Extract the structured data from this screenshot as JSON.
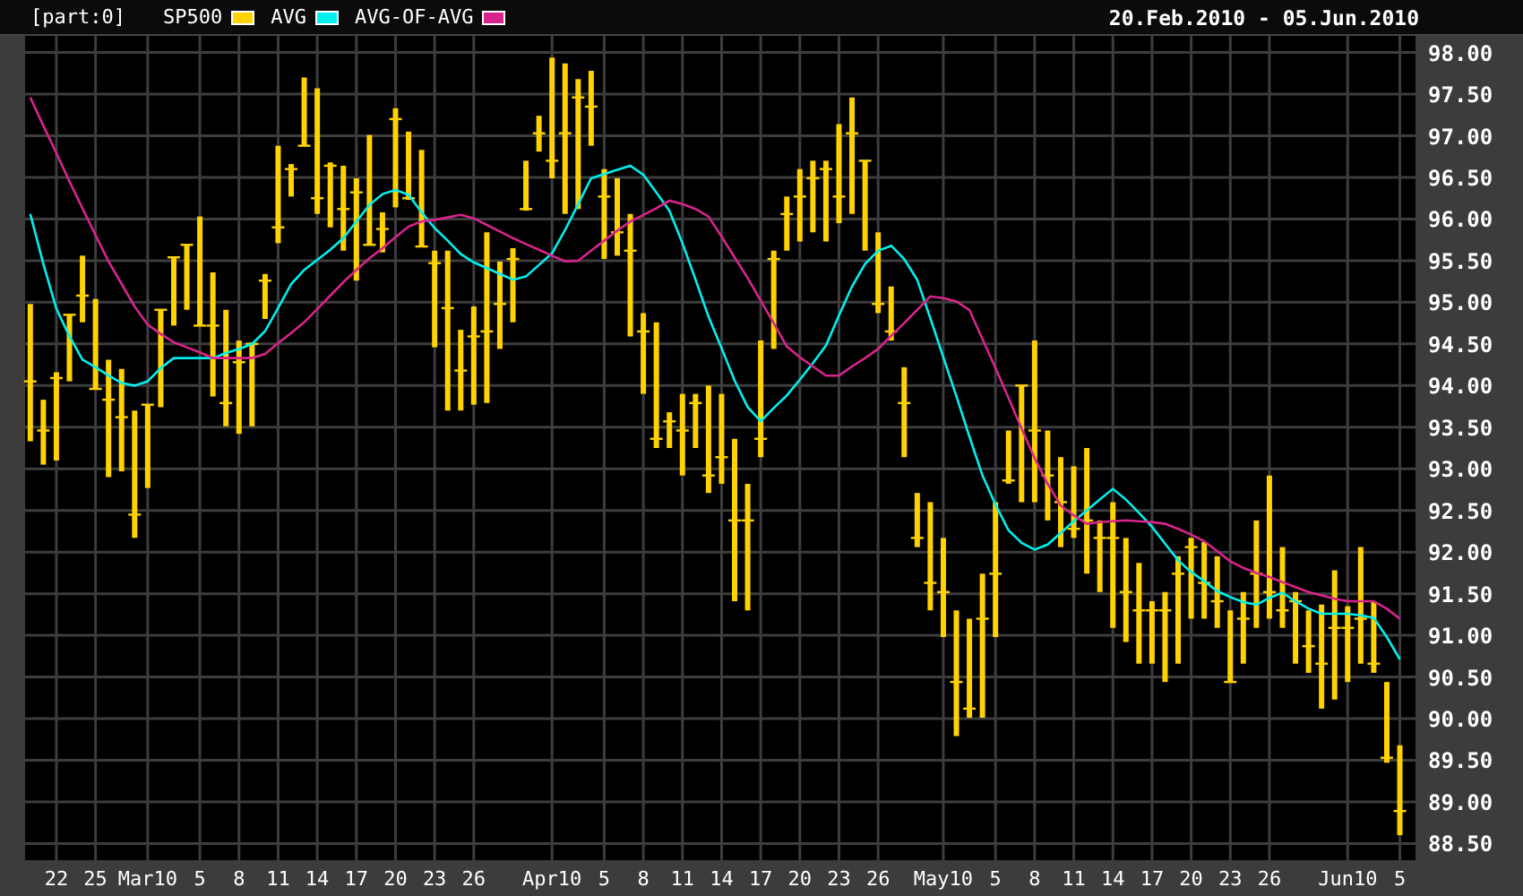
{
  "header": {
    "part_label": "[part:0]",
    "date_range": "20.Feb.2010 - 05.Jun.2010"
  },
  "chart": {
    "chart_data": {
      "type": "candlestick",
      "grid": true,
      "categories": [
        null,
        null,
        "22",
        null,
        null,
        "25",
        null,
        null,
        null,
        "Mar10",
        null,
        null,
        null,
        "5",
        null,
        null,
        "8",
        null,
        null,
        "11",
        null,
        null,
        "14",
        null,
        null,
        "17",
        null,
        null,
        "20",
        null,
        null,
        "23",
        null,
        null,
        "26",
        null,
        null,
        null,
        null,
        null,
        "Apr10",
        null,
        null,
        null,
        "5",
        null,
        null,
        "8",
        null,
        null,
        "11",
        null,
        null,
        "14",
        null,
        null,
        "17",
        null,
        null,
        "20",
        null,
        null,
        "23",
        null,
        null,
        "26",
        null,
        null,
        null,
        null,
        "May10",
        null,
        null,
        null,
        "5",
        null,
        null,
        "8",
        null,
        null,
        "11",
        null,
        null,
        "14",
        null,
        null,
        "17",
        null,
        null,
        "20",
        null,
        null,
        "23",
        null,
        null,
        "26",
        null,
        null,
        null,
        null,
        null,
        "Jun10",
        null,
        null,
        null,
        "5"
      ],
      "ylim": [
        88.3,
        98.2
      ],
      "yticks": [
        {
          "value": 88.5,
          "label": "88.50"
        },
        {
          "value": 89,
          "label": "89.00"
        },
        {
          "value": 89.5,
          "label": "89.50"
        },
        {
          "value": 90,
          "label": "90.00"
        },
        {
          "value": 90.5,
          "label": "90.50"
        },
        {
          "value": 91,
          "label": "91.00"
        },
        {
          "value": 91.5,
          "label": "91.50"
        },
        {
          "value": 92,
          "label": "92.00"
        },
        {
          "value": 92.5,
          "label": "92.50"
        },
        {
          "value": 93,
          "label": "93.00"
        },
        {
          "value": 93.5,
          "label": "93.50"
        },
        {
          "value": 94,
          "label": "94.00"
        },
        {
          "value": 94.5,
          "label": "94.50"
        },
        {
          "value": 95,
          "label": "95.00"
        },
        {
          "value": 95.5,
          "label": "95.50"
        },
        {
          "value": 96,
          "label": "96.00"
        },
        {
          "value": 96.5,
          "label": "96.50"
        },
        {
          "value": 97,
          "label": "97.00"
        },
        {
          "value": 97.5,
          "label": "97.50"
        },
        {
          "value": 98,
          "label": "98.00"
        }
      ],
      "series": [
        {
          "name": "SP500",
          "color": "#ffd200",
          "ohlc": [
            [
              94.05,
              94.98,
              93.33,
              94.05
            ],
            [
              93.46,
              93.83,
              93.05,
              93.46
            ],
            [
              94.09,
              94.16,
              93.1,
              94.09
            ],
            [
              94.85,
              94.85,
              94.05,
              94.85
            ],
            [
              95.08,
              95.56,
              94.76,
              95.08
            ],
            [
              93.96,
              95.04,
              93.96,
              93.96
            ],
            [
              93.83,
              94.31,
              92.9,
              93.83
            ],
            [
              93.62,
              94.2,
              92.97,
              93.62
            ],
            [
              92.45,
              93.7,
              92.17,
              92.45
            ],
            [
              93.77,
              93.77,
              92.77,
              93.77
            ],
            [
              94.91,
              94.91,
              93.74,
              94.91
            ],
            [
              95.54,
              95.54,
              94.72,
              95.54
            ],
            [
              95.69,
              95.69,
              94.91,
              95.69
            ],
            [
              94.72,
              96.03,
              94.72,
              94.72
            ],
            [
              94.72,
              95.36,
              93.87,
              94.72
            ],
            [
              93.79,
              94.91,
              93.51,
              93.79
            ],
            [
              94.28,
              94.54,
              93.42,
              94.28
            ],
            [
              94.5,
              94.52,
              93.51,
              94.5
            ],
            [
              95.26,
              95.34,
              94.8,
              95.26
            ],
            [
              95.9,
              96.88,
              95.71,
              95.9
            ],
            [
              96.6,
              96.66,
              96.27,
              96.6
            ],
            [
              96.88,
              97.7,
              96.88,
              96.88
            ],
            [
              96.25,
              97.57,
              96.06,
              96.25
            ],
            [
              96.64,
              96.68,
              95.9,
              96.64
            ],
            [
              96.12,
              96.64,
              95.62,
              96.12
            ],
            [
              96.32,
              96.49,
              95.26,
              96.32
            ],
            [
              95.69,
              97.01,
              95.69,
              95.69
            ],
            [
              95.88,
              96.08,
              95.6,
              95.88
            ],
            [
              97.2,
              97.33,
              96.14,
              97.2
            ],
            [
              96.25,
              97.05,
              96.23,
              96.25
            ],
            [
              95.67,
              96.83,
              95.67,
              95.67
            ],
            [
              95.47,
              95.62,
              94.46,
              95.47
            ],
            [
              94.93,
              95.62,
              93.7,
              94.93
            ],
            [
              94.18,
              94.67,
              93.7,
              94.18
            ],
            [
              94.59,
              94.95,
              93.77,
              94.59
            ],
            [
              94.65,
              95.84,
              93.79,
              94.65
            ],
            [
              94.98,
              95.49,
              94.44,
              94.98
            ],
            [
              95.52,
              95.65,
              94.76,
              95.52
            ],
            [
              96.12,
              96.7,
              96.1,
              96.12
            ],
            [
              97.03,
              97.24,
              96.81,
              97.03
            ],
            [
              96.7,
              97.94,
              96.49,
              96.7
            ],
            [
              97.03,
              97.87,
              96.06,
              97.03
            ],
            [
              97.46,
              97.68,
              96.12,
              97.46
            ],
            [
              97.35,
              97.78,
              96.88,
              97.35
            ],
            [
              96.27,
              96.6,
              95.52,
              96.27
            ],
            [
              95.84,
              96.49,
              95.56,
              95.84
            ],
            [
              95.62,
              96.06,
              94.59,
              95.62
            ],
            [
              94.65,
              94.87,
              93.9,
              94.65
            ],
            [
              93.36,
              94.76,
              93.25,
              93.36
            ],
            [
              93.57,
              93.68,
              93.25,
              93.57
            ],
            [
              93.46,
              93.9,
              92.92,
              93.46
            ],
            [
              93.79,
              93.9,
              93.25,
              93.79
            ],
            [
              92.92,
              94.0,
              92.71,
              92.92
            ],
            [
              93.14,
              93.9,
              92.82,
              93.14
            ],
            [
              92.38,
              93.36,
              91.41,
              92.38
            ],
            [
              92.38,
              92.82,
              91.3,
              92.38
            ],
            [
              93.36,
              94.54,
              93.14,
              93.36
            ],
            [
              95.52,
              95.62,
              94.44,
              95.52
            ],
            [
              96.06,
              96.27,
              95.62,
              96.06
            ],
            [
              96.27,
              96.6,
              95.73,
              96.27
            ],
            [
              96.49,
              96.7,
              95.84,
              96.49
            ],
            [
              96.6,
              96.7,
              95.73,
              96.6
            ],
            [
              96.27,
              97.14,
              95.95,
              96.27
            ],
            [
              97.03,
              97.46,
              96.06,
              97.03
            ],
            [
              96.7,
              96.7,
              95.62,
              96.7
            ],
            [
              94.98,
              95.84,
              94.87,
              94.98
            ],
            [
              94.65,
              95.19,
              94.54,
              94.65
            ],
            [
              93.79,
              94.22,
              93.14,
              93.79
            ],
            [
              92.17,
              92.71,
              92.06,
              92.17
            ],
            [
              91.63,
              92.6,
              91.3,
              91.63
            ],
            [
              91.52,
              92.17,
              90.98,
              91.52
            ],
            [
              90.44,
              91.3,
              89.79,
              90.44
            ],
            [
              90.12,
              91.2,
              90.01,
              90.12
            ],
            [
              91.2,
              91.74,
              90.01,
              91.2
            ],
            [
              91.74,
              92.6,
              90.98,
              91.74
            ],
            [
              92.86,
              93.46,
              92.82,
              92.86
            ],
            [
              94.0,
              94.0,
              92.6,
              94.0
            ],
            [
              93.46,
              94.54,
              92.6,
              93.46
            ],
            [
              92.92,
              93.46,
              92.38,
              92.92
            ],
            [
              92.6,
              93.14,
              92.06,
              92.6
            ],
            [
              92.28,
              93.03,
              92.17,
              92.28
            ],
            [
              92.38,
              93.25,
              91.74,
              92.38
            ],
            [
              92.17,
              92.38,
              91.52,
              92.17
            ],
            [
              92.17,
              92.6,
              91.09,
              92.17
            ],
            [
              91.52,
              92.17,
              90.92,
              91.52
            ],
            [
              91.3,
              91.87,
              90.66,
              91.3
            ],
            [
              91.3,
              91.41,
              90.66,
              91.3
            ],
            [
              91.3,
              91.52,
              90.44,
              91.3
            ],
            [
              91.74,
              91.95,
              90.66,
              91.74
            ],
            [
              92.06,
              92.17,
              91.2,
              92.06
            ],
            [
              91.63,
              92.12,
              91.2,
              91.63
            ],
            [
              91.41,
              91.95,
              91.09,
              91.41
            ],
            [
              90.44,
              91.3,
              90.44,
              90.44
            ],
            [
              91.2,
              91.52,
              90.66,
              91.2
            ],
            [
              91.74,
              92.38,
              91.09,
              91.74
            ],
            [
              91.52,
              92.92,
              91.2,
              91.52
            ],
            [
              91.3,
              92.06,
              91.09,
              91.3
            ],
            [
              91.41,
              91.52,
              90.66,
              91.41
            ],
            [
              90.87,
              91.3,
              90.55,
              90.87
            ],
            [
              90.66,
              91.37,
              90.12,
              90.66
            ],
            [
              91.09,
              91.78,
              90.23,
              91.09
            ],
            [
              91.09,
              91.35,
              90.44,
              91.09
            ],
            [
              91.2,
              92.06,
              90.66,
              91.2
            ],
            [
              90.66,
              91.41,
              90.55,
              90.66
            ],
            [
              89.53,
              90.44,
              89.47,
              89.53
            ],
            [
              88.89,
              89.68,
              88.6,
              88.89
            ]
          ]
        },
        {
          "name": "AVG",
          "color": "#00f0f0",
          "type": "line",
          "values": [
            96.06,
            95.46,
            94.92,
            94.59,
            94.31,
            94.22,
            94.12,
            94.03,
            94.0,
            94.05,
            94.21,
            94.33,
            94.33,
            94.33,
            94.33,
            94.39,
            94.44,
            94.5,
            94.65,
            94.93,
            95.22,
            95.39,
            95.51,
            95.63,
            95.77,
            95.97,
            96.17,
            96.3,
            96.35,
            96.29,
            96.08,
            95.89,
            95.74,
            95.58,
            95.48,
            95.41,
            95.34,
            95.27,
            95.31,
            95.45,
            95.59,
            95.87,
            96.18,
            96.49,
            96.54,
            96.59,
            96.64,
            96.53,
            96.32,
            96.1,
            95.71,
            95.27,
            94.83,
            94.45,
            94.06,
            93.74,
            93.57,
            93.73,
            93.88,
            94.07,
            94.27,
            94.48,
            94.84,
            95.19,
            95.46,
            95.62,
            95.68,
            95.52,
            95.27,
            94.81,
            94.34,
            93.87,
            93.39,
            92.92,
            92.57,
            92.26,
            92.11,
            92.03,
            92.09,
            92.23,
            92.37,
            92.5,
            92.63,
            92.76,
            92.63,
            92.47,
            92.3,
            92.1,
            91.9,
            91.76,
            91.65,
            91.53,
            91.46,
            91.4,
            91.37,
            91.45,
            91.51,
            91.41,
            91.32,
            91.26,
            91.26,
            91.26,
            91.24,
            91.21,
            90.98,
            90.71
          ]
        },
        {
          "name": "AVG-OF-AVG",
          "color": "#d8248c",
          "type": "line",
          "values": [
            97.46,
            97.12,
            96.79,
            96.45,
            96.13,
            95.81,
            95.49,
            95.22,
            94.95,
            94.73,
            94.62,
            94.52,
            94.46,
            94.4,
            94.33,
            94.33,
            94.33,
            94.33,
            94.38,
            94.51,
            94.63,
            94.76,
            94.92,
            95.08,
            95.24,
            95.39,
            95.53,
            95.65,
            95.78,
            95.91,
            95.97,
            95.99,
            96.02,
            96.05,
            96.01,
            95.93,
            95.85,
            95.77,
            95.7,
            95.63,
            95.56,
            95.49,
            95.5,
            95.62,
            95.74,
            95.86,
            95.97,
            96.05,
            96.13,
            96.22,
            96.18,
            96.12,
            96.03,
            95.79,
            95.54,
            95.29,
            95.02,
            94.75,
            94.47,
            94.34,
            94.23,
            94.12,
            94.12,
            94.23,
            94.33,
            94.44,
            94.6,
            94.75,
            94.91,
            95.07,
            95.05,
            95.01,
            94.91,
            94.56,
            94.21,
            93.85,
            93.48,
            93.13,
            92.82,
            92.56,
            92.44,
            92.34,
            92.36,
            92.37,
            92.38,
            92.37,
            92.36,
            92.34,
            92.28,
            92.21,
            92.13,
            92.01,
            91.89,
            91.81,
            91.75,
            91.7,
            91.64,
            91.58,
            91.52,
            91.48,
            91.44,
            91.41,
            91.41,
            91.41,
            91.32,
            91.2
          ]
        }
      ]
    }
  }
}
